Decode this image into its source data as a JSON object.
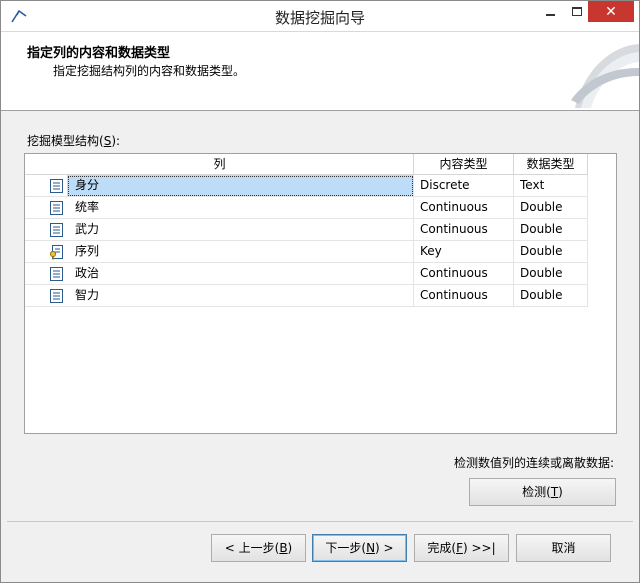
{
  "window": {
    "title": "数据挖掘向导"
  },
  "banner": {
    "title": "指定列的内容和数据类型",
    "subtitle": "指定挖掘结构列的内容和数据类型。"
  },
  "grid": {
    "label_prefix": "挖掘模型结构(",
    "label_key": "S",
    "label_suffix": "):",
    "headers": [
      "列",
      "内容类型",
      "数据类型"
    ],
    "rows": [
      {
        "icon": "column-icon",
        "name": "身分",
        "content_type": "Discrete",
        "data_type": "Text",
        "selected": true
      },
      {
        "icon": "column-icon",
        "name": "统率",
        "content_type": "Continuous",
        "data_type": "Double"
      },
      {
        "icon": "column-icon",
        "name": "武力",
        "content_type": "Continuous",
        "data_type": "Double"
      },
      {
        "icon": "key-column-icon",
        "name": "序列",
        "content_type": "Key",
        "data_type": "Double"
      },
      {
        "icon": "column-icon",
        "name": "政治",
        "content_type": "Continuous",
        "data_type": "Double"
      },
      {
        "icon": "column-icon",
        "name": "智力",
        "content_type": "Continuous",
        "data_type": "Double"
      }
    ]
  },
  "detect": {
    "label": "检测数值列的连续或离散数据:",
    "button_prefix": "检测(",
    "button_key": "T",
    "button_suffix": ")"
  },
  "footer": {
    "back": {
      "prefix": "< 上一步(",
      "key": "B",
      "suffix": ")"
    },
    "next": {
      "prefix": "下一步(",
      "key": "N",
      "suffix": ") >"
    },
    "finish": {
      "prefix": "完成(",
      "key": "F",
      "suffix": ") >>|"
    },
    "cancel": {
      "label": "取消"
    }
  },
  "colors": {
    "selection": "#bcdcf8",
    "close_button": "#c7372f",
    "default_button_border": "#3c7fb1"
  }
}
